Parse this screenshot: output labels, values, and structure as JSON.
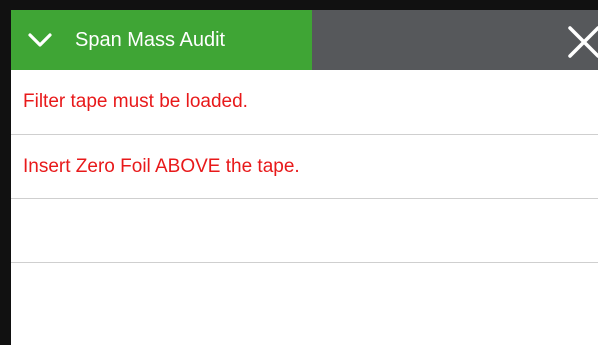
{
  "header": {
    "title": "Span Mass Audit",
    "collapse_icon": "chevron-down-icon",
    "close_icon": "close-icon",
    "colors": {
      "title_bar": "#3fa535",
      "bar_rest": "#56585b"
    }
  },
  "messages": [
    {
      "text": "Filter tape must be loaded."
    },
    {
      "text": "Insert Zero Foil ABOVE the tape."
    },
    {
      "text": ""
    }
  ],
  "message_color": "#e8191a"
}
